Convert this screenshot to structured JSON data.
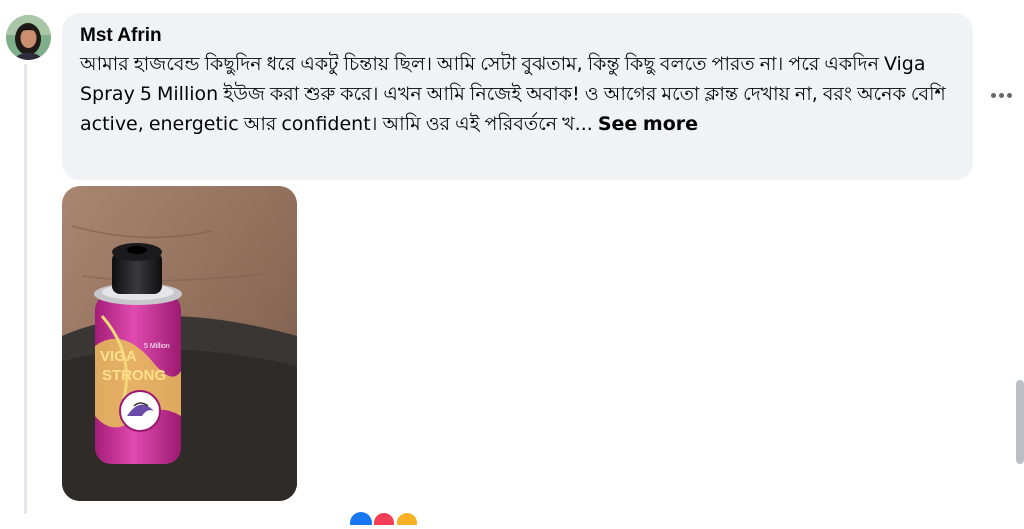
{
  "comment": {
    "author": "Mst Afrin",
    "text": "আমার হাজবেন্ড কিছুদিন ধরে একটু চিন্তায় ছিল। আমি সেটা বুঝতাম, কিন্তু কিছু বলতে পারত না। পরে একদিন Viga Spray 5 Million ইউজ করা শুরু করে। এখন আমি নিজেই অবাক! ও আগের মতো ক্লান্ত দেখায় না, বরং অনেক বেশি active, energetic আর confident। আমি ওর এই পরিবর্তনে খ...",
    "see_more": "See more"
  },
  "photo": {
    "product_text": "VIGA STRONG",
    "product_small_text": "5 Million"
  },
  "colors": {
    "bubble_bg": "#f0f2f5",
    "text": "#050505",
    "can_pink": "#d42f9d",
    "reaction_like": "#1877f2",
    "reaction_love": "#f33e58",
    "reaction_haha": "#f7b125"
  },
  "icons": [
    "avatar",
    "more-options-icon",
    "like-reaction-icon",
    "love-reaction-icon",
    "haha-reaction-icon"
  ]
}
